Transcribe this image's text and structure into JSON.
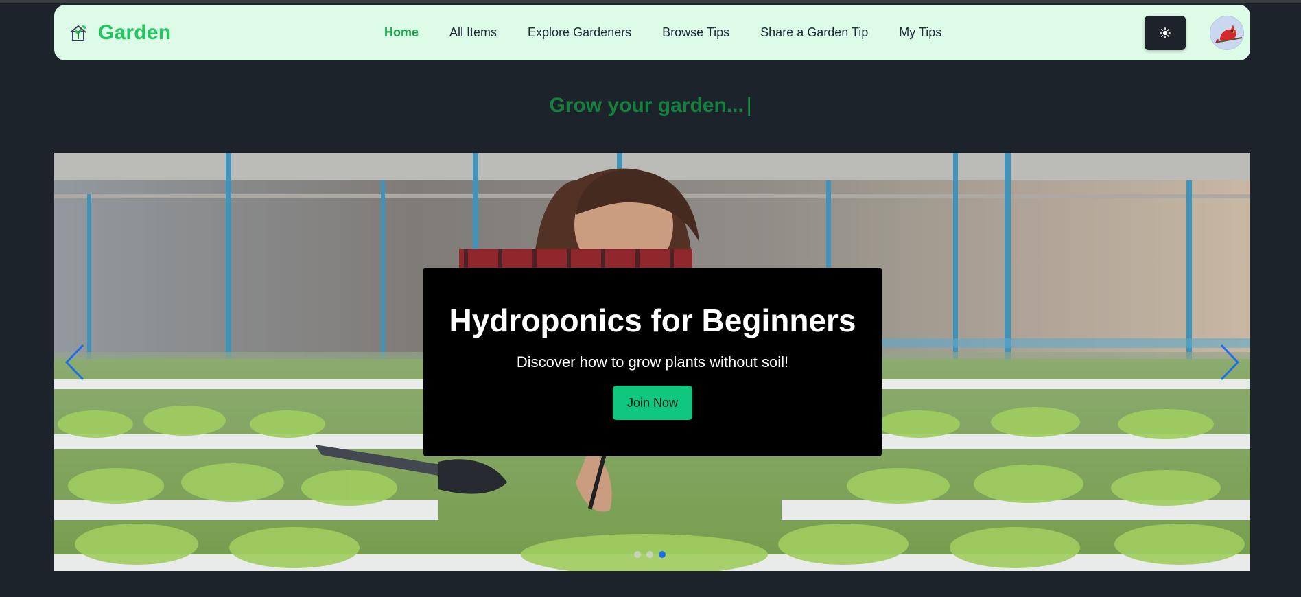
{
  "brand": {
    "name": "Garden",
    "logo_icon": "house-plant-icon"
  },
  "nav": {
    "links": [
      {
        "label": "Home",
        "active": true
      },
      {
        "label": "All Items",
        "active": false
      },
      {
        "label": "Explore Gardeners",
        "active": false
      },
      {
        "label": "Browse Tips",
        "active": false
      },
      {
        "label": "Share a Garden Tip",
        "active": false
      },
      {
        "label": "My Tips",
        "active": false
      }
    ],
    "theme_toggle_icon": "sun-icon",
    "avatar_icon": "cardinal-bird-avatar"
  },
  "hero": {
    "tagline": "Grow your garden...",
    "cursor": "|"
  },
  "carousel": {
    "image_description": "woman tending hydroponic lettuce in greenhouse",
    "slide": {
      "title": "Hydroponics for Beginners",
      "subtitle": "Discover how to grow plants without soil!",
      "cta_label": "Join Now"
    },
    "prev_icon": "chevron-left-icon",
    "next_icon": "chevron-right-icon",
    "total_slides": 3,
    "active_slide": 3
  },
  "colors": {
    "page_bg": "#1d232a",
    "navbar_bg": "#dcfce7",
    "brand": "#22c55e",
    "active_link": "#16a34a",
    "tagline": "#15803d",
    "cta": "#10c77f",
    "arrows": "#1d6fe8"
  }
}
